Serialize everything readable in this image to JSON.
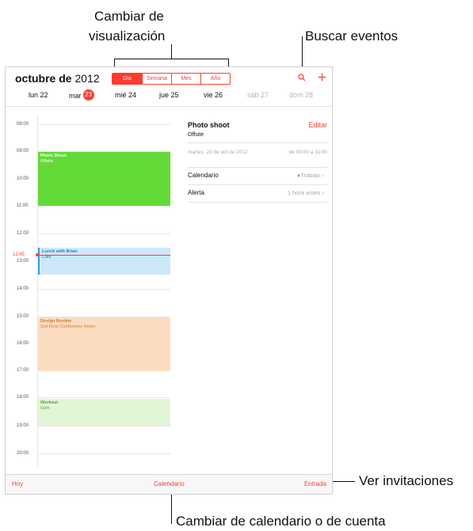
{
  "callouts": {
    "view_switch_line1": "Cambiar de",
    "view_switch_line2": "visualización",
    "search": "Buscar eventos",
    "invitations": "Ver invitaciones",
    "calendar_account": "Cambiar de calendario o de cuenta"
  },
  "header": {
    "month": "octubre de",
    "year": "2012",
    "segments": [
      "Día",
      "Semana",
      "Mes",
      "Año"
    ],
    "selected_segment": "Día",
    "search_icon": "search-icon",
    "add_icon": "plus-icon"
  },
  "week": {
    "days": [
      "lun 22",
      "mar",
      "mié 24",
      "jue 25",
      "vie 26",
      "sáb 27",
      "dom 28"
    ],
    "today_number": "23"
  },
  "timeline": {
    "hours": [
      "08:00",
      "09:00",
      "10:00",
      "11:00",
      "12:00",
      "13:00",
      "14:00",
      "15:00",
      "16:00",
      "17:00",
      "18:00",
      "19:00",
      "20:00"
    ],
    "now_label": "12:45"
  },
  "events": [
    {
      "title": "Photo Shoot",
      "location": "Offsite",
      "color": "#63da38"
    },
    {
      "title": "Lunch with Brian",
      "location": "Cafe",
      "color": "#cde8fb"
    },
    {
      "title": "Design Review",
      "location": "2nd Floor Conference Room",
      "color": "#fcdcc0"
    },
    {
      "title": "Workout",
      "location": "Gym",
      "color": "#e1f6d6"
    }
  ],
  "detail": {
    "title": "Photo shoot",
    "edit": "Editar",
    "location": "Offsite",
    "date": "martes, 23 de oct de 2012",
    "time": "de 09:00 a 11:00",
    "calendar_label": "Calendario",
    "calendar_value": "Trabajo",
    "alert_label": "Alerta",
    "alert_value": "1 hora antes"
  },
  "bottom_bar": {
    "today": "Hoy",
    "calendars": "Calendario",
    "inbox": "Entrada"
  },
  "colors": {
    "accent": "#ff3b30",
    "work_dot": "#4cd964"
  }
}
